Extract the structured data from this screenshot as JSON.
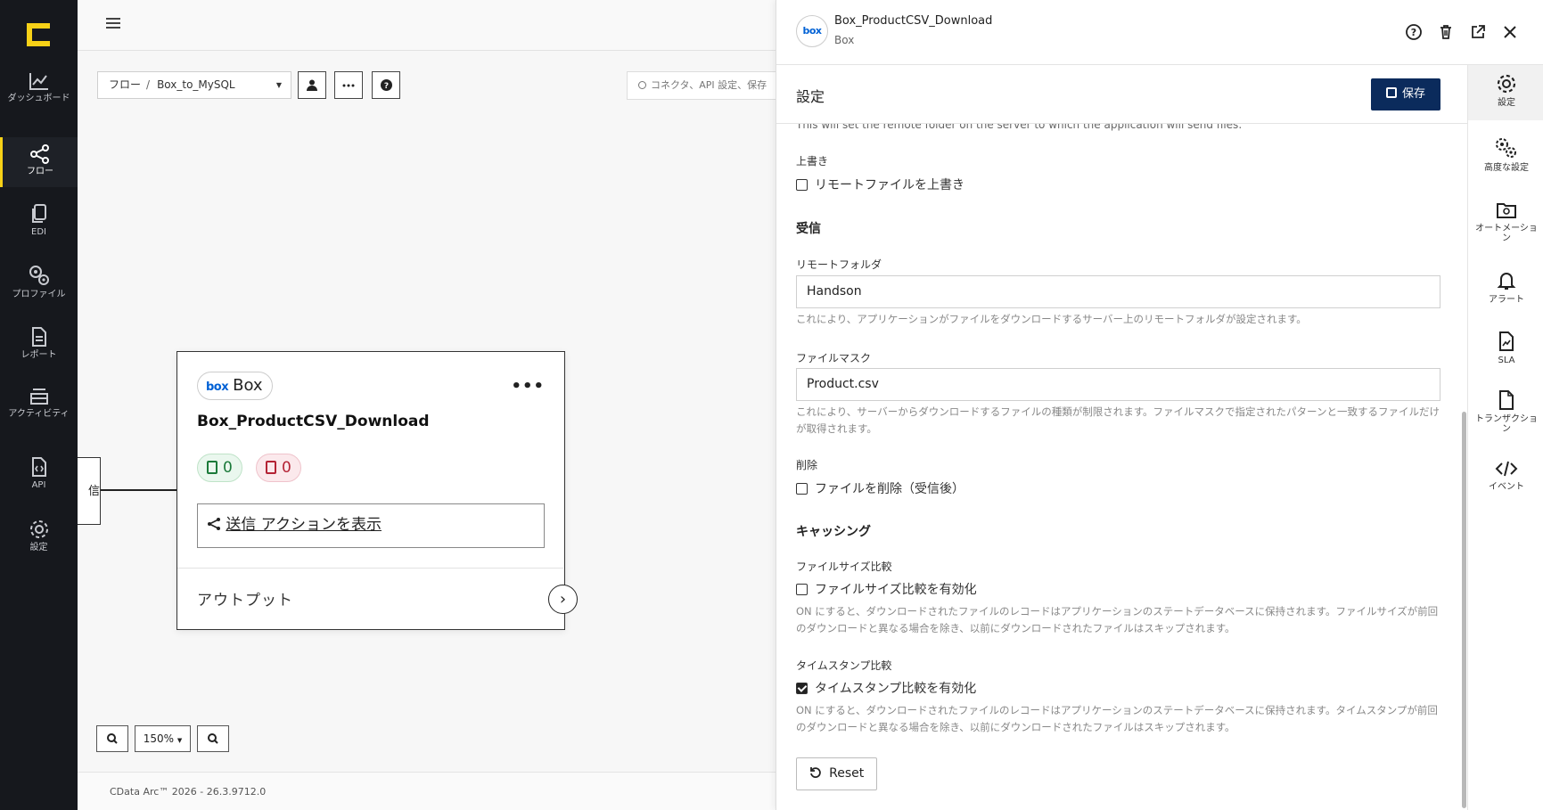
{
  "leftnav": {
    "items": [
      {
        "label": "ダッシュボード",
        "icon": "dashboard-icon"
      },
      {
        "label": "フロー",
        "icon": "flow-icon",
        "active": true
      },
      {
        "label": "EDI",
        "icon": "edi-icon"
      },
      {
        "label": "プロファイル",
        "icon": "profile-icon"
      },
      {
        "label": "レポート",
        "icon": "report-icon"
      },
      {
        "label": "アクティビティ",
        "icon": "activity-icon"
      },
      {
        "label": "API",
        "icon": "api-icon"
      },
      {
        "label": "設定",
        "icon": "settings-icon"
      }
    ]
  },
  "canvas": {
    "breadcrumb_root": "フロー",
    "breadcrumb_sep": "/",
    "breadcrumb_current": "Box_to_MySQL",
    "search_placeholder": "コネクタ、API 設定、保存",
    "prev_node_text": "信",
    "zoom_level": "150%",
    "footer": "CData Arc™ 2026 - 26.3.9712.0"
  },
  "node": {
    "badge_logo": "box",
    "badge_label": "Box",
    "menu": "•••",
    "title": "Box_ProductCSV_Download",
    "success_count": "0",
    "error_count": "0",
    "send_action": "送信 アクションを表示",
    "output_label": "アウトプット"
  },
  "panel": {
    "connector_logo": "box",
    "connector_name": "Box_ProductCSV_Download",
    "connector_type": "Box",
    "settings_title": "設定",
    "save_label": "保存",
    "truncated_help": "This will set the remote folder on the server to which the application will send files.",
    "overwrite": {
      "label": "上書き",
      "checkbox": "リモートファイルを上書き",
      "checked": false
    },
    "receive_section": "受信",
    "remote_folder": {
      "label": "リモートフォルダ",
      "value": "Handson",
      "help": "これにより、アプリケーションがファイルをダウンロードするサーバー上のリモートフォルダが設定されます。"
    },
    "file_mask": {
      "label": "ファイルマスク",
      "value": "Product.csv",
      "help": "これにより、サーバーからダウンロードするファイルの種類が制限されます。ファイルマスクで指定されたパターンと一致するファイルだけが取得されます。"
    },
    "delete": {
      "label": "削除",
      "checkbox": "ファイルを削除（受信後）",
      "checked": false
    },
    "caching_section": "キャッシング",
    "filesize": {
      "label": "ファイルサイズ比較",
      "checkbox": "ファイルサイズ比較を有効化",
      "checked": false,
      "help": "ON にすると、ダウンロードされたファイルのレコードはアプリケーションのステートデータベースに保持されます。ファイルサイズが前回のダウンロードと異なる場合を除き、以前にダウンロードされたファイルはスキップされます。"
    },
    "timestamp": {
      "label": "タイムスタンプ比較",
      "checkbox": "タイムスタンプ比較を有効化",
      "checked": true,
      "help": "ON にすると、ダウンロードされたファイルのレコードはアプリケーションのステートデータベースに保持されます。タイムスタンプが前回のダウンロードと異なる場合を除き、以前にダウンロードされたファイルはスキップされます。"
    },
    "reset_label": "Reset"
  },
  "tabs": [
    {
      "label": "設定",
      "icon": "gear-icon",
      "active": true
    },
    {
      "label": "高度な設定",
      "icon": "gears-icon"
    },
    {
      "label": "オートメーション",
      "icon": "automation-folder-icon"
    },
    {
      "label": "アラート",
      "icon": "bell-icon"
    },
    {
      "label": "SLA",
      "icon": "sla-icon"
    },
    {
      "label": "トランザクション",
      "icon": "transaction-file-icon"
    },
    {
      "label": "イベント",
      "icon": "code-icon"
    }
  ]
}
